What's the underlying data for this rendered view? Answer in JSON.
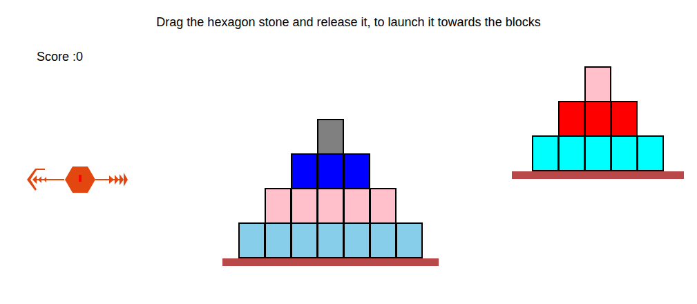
{
  "instruction": "Drag the hexagon stone and release it, to launch it towards the blocks",
  "score": {
    "label": "Score :",
    "value": "0"
  },
  "towers": [
    {
      "rows": [
        {
          "color": "#808080",
          "count": 1
        },
        {
          "color": "#0000ff",
          "count": 3
        },
        {
          "color": "#ffc0cb",
          "count": 5
        },
        {
          "color": "#87ceeb",
          "count": 7
        }
      ]
    },
    {
      "rows": [
        {
          "color": "#ffc0cb",
          "count": 1
        },
        {
          "color": "#ff0000",
          "count": 3
        },
        {
          "color": "#00ffff",
          "count": 5
        }
      ]
    }
  ]
}
